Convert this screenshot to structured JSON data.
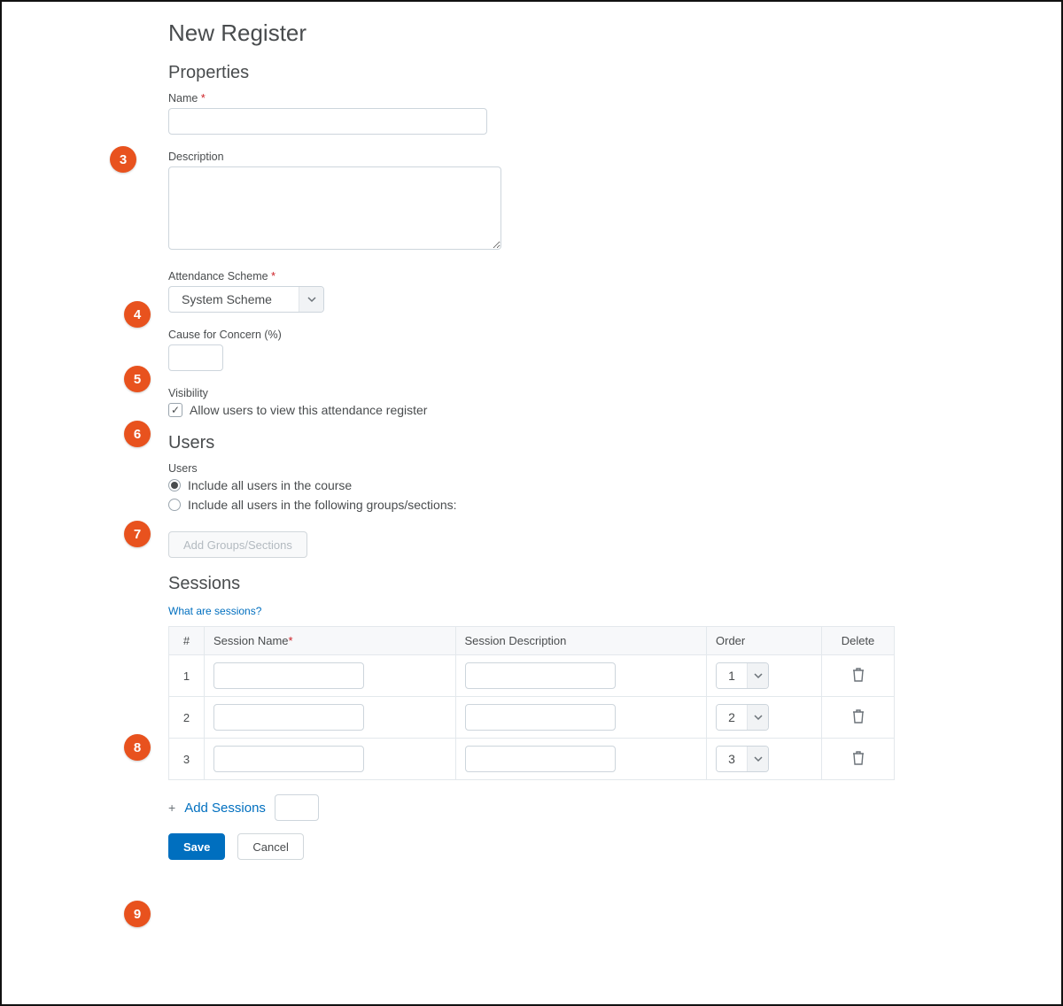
{
  "page": {
    "title": "New Register"
  },
  "properties": {
    "heading": "Properties",
    "name_label": "Name",
    "name_value": "",
    "description_label": "Description",
    "description_value": "",
    "scheme_label": "Attendance Scheme",
    "scheme_selected": "System Scheme",
    "concern_label": "Cause for Concern (%)",
    "concern_value": "",
    "visibility_label": "Visibility",
    "visibility_option": "Allow users to view this attendance register",
    "visibility_checked": true
  },
  "users": {
    "heading": "Users",
    "sub_label": "Users",
    "option_all": "Include all users in the course",
    "option_groups": "Include all users in the following groups/sections:",
    "selected": "all",
    "add_groups_label": "Add Groups/Sections"
  },
  "sessions": {
    "heading": "Sessions",
    "help_link": "What are sessions?",
    "columns": {
      "num": "#",
      "name": "Session Name",
      "desc": "Session Description",
      "order": "Order",
      "delete": "Delete"
    },
    "rows": [
      {
        "num": "1",
        "name": "",
        "desc": "",
        "order": "1"
      },
      {
        "num": "2",
        "name": "",
        "desc": "",
        "order": "2"
      },
      {
        "num": "3",
        "name": "",
        "desc": "",
        "order": "3"
      }
    ],
    "add_link": "Add Sessions",
    "add_count_value": ""
  },
  "actions": {
    "save": "Save",
    "cancel": "Cancel"
  },
  "badges": {
    "b3": "3",
    "b4": "4",
    "b5": "5",
    "b6": "6",
    "b7": "7",
    "b8": "8",
    "b9": "9"
  }
}
